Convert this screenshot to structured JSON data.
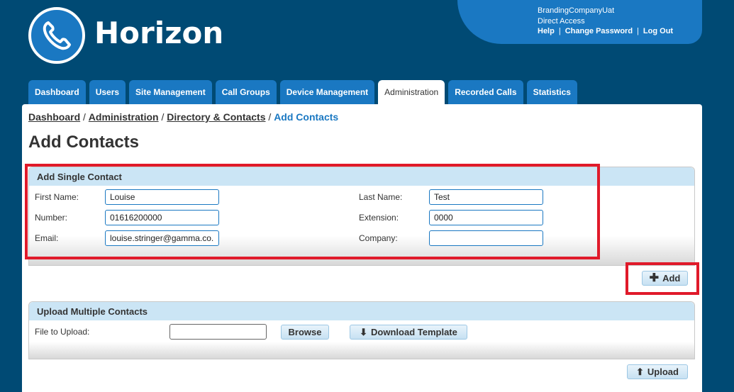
{
  "brand": {
    "name": "Horizon"
  },
  "user_panel": {
    "company": "BrandingCompanyUat",
    "access": "Direct Access",
    "help": "Help",
    "change_password": "Change Password",
    "logout": "Log Out"
  },
  "tabs": [
    {
      "label": "Dashboard"
    },
    {
      "label": "Users"
    },
    {
      "label": "Site Management"
    },
    {
      "label": "Call Groups"
    },
    {
      "label": "Device Management"
    },
    {
      "label": "Administration",
      "active": true
    },
    {
      "label": "Recorded Calls"
    },
    {
      "label": "Statistics"
    }
  ],
  "breadcrumb": {
    "items": [
      "Dashboard",
      "Administration",
      "Directory & Contacts"
    ],
    "current": "Add Contacts",
    "separator": "/"
  },
  "page_title": "Add Contacts",
  "single_contact": {
    "title": "Add Single Contact",
    "first_name": {
      "label": "First Name:",
      "value": "Louise"
    },
    "last_name": {
      "label": "Last Name:",
      "value": "Test"
    },
    "number": {
      "label": "Number:",
      "value": "01616200000"
    },
    "extension": {
      "label": "Extension:",
      "value": "0000"
    },
    "email": {
      "label": "Email:",
      "value": "louise.stringer@gamma.co.uk"
    },
    "company": {
      "label": "Company:",
      "value": ""
    },
    "add_button": "Add"
  },
  "multiple_contacts": {
    "title": "Upload Multiple Contacts",
    "file_label": "File to Upload:",
    "file_value": "",
    "browse_button": "Browse",
    "download_button": "Download Template",
    "upload_button": "Upload"
  },
  "colors": {
    "background": "#004a74",
    "accent": "#1a78c2",
    "section_header": "#cbe5f5",
    "highlight": "#e01a2a"
  }
}
